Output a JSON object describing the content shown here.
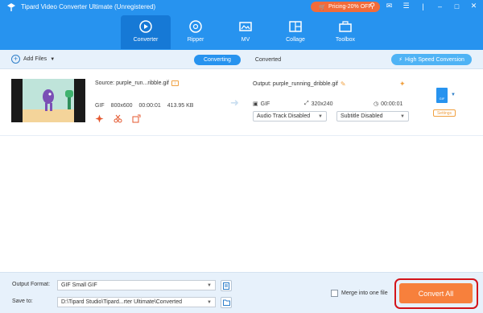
{
  "window": {
    "title": "Tipard Video Converter Ultimate (Unregistered)",
    "promo_label": "Pricing-20% OFF"
  },
  "nav": {
    "items": [
      {
        "label": "Converter",
        "icon": "converter-icon"
      },
      {
        "label": "Ripper",
        "icon": "ripper-icon"
      },
      {
        "label": "MV",
        "icon": "mv-icon"
      },
      {
        "label": "Collage",
        "icon": "collage-icon"
      },
      {
        "label": "Toolbox",
        "icon": "toolbox-icon"
      }
    ],
    "active": "Converter"
  },
  "toolbar": {
    "add_files": "Add Files",
    "tabs": [
      "Converting",
      "Converted"
    ],
    "active_tab": "Converting",
    "high_speed": "High Speed Conversion"
  },
  "file": {
    "source_label": "Source: purple_run...ribble.gif",
    "format": "GIF",
    "resolution": "800x600",
    "duration": "00:00:01",
    "size": "413.95 KB",
    "output_label": "Output: purple_running_dribble.gif",
    "out_format": "GIF",
    "out_resolution": "320x240",
    "out_duration": "00:00:01",
    "audio_track": "Audio Track Disabled",
    "subtitle": "Subtitle Disabled",
    "format_badge": "GIF",
    "settings_label": "Settings"
  },
  "bottom": {
    "output_format_label": "Output Format:",
    "output_format_value": "GIF Small GIF",
    "save_to_label": "Save to:",
    "save_to_value": "D:\\Tipard Studio\\Tipard...rter Ultimate\\Converted",
    "merge_label": "Merge into one file",
    "convert_all_label": "Convert All"
  },
  "colors": {
    "header": "#2793ef",
    "accent_orange": "#f7803c",
    "highlight_red": "#d3141a"
  }
}
